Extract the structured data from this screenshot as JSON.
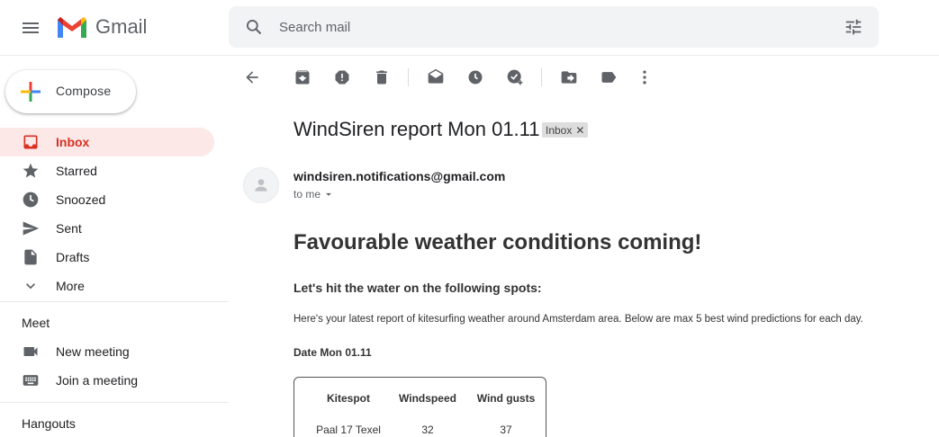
{
  "app": {
    "name": "Gmail"
  },
  "search": {
    "placeholder": "Search mail"
  },
  "compose": {
    "label": "Compose"
  },
  "nav": [
    {
      "label": "Inbox",
      "icon": "inbox-icon",
      "active": true
    },
    {
      "label": "Starred",
      "icon": "star-icon"
    },
    {
      "label": "Snoozed",
      "icon": "clock-icon"
    },
    {
      "label": "Sent",
      "icon": "send-icon"
    },
    {
      "label": "Drafts",
      "icon": "draft-icon"
    },
    {
      "label": "More",
      "icon": "chevron-down-icon"
    }
  ],
  "meet": {
    "title": "Meet",
    "items": [
      {
        "label": "New meeting",
        "icon": "video-icon"
      },
      {
        "label": "Join a meeting",
        "icon": "keyboard-icon"
      }
    ]
  },
  "hangouts": {
    "title": "Hangouts"
  },
  "toolbar": {
    "icons": [
      "back-icon",
      "archive-icon",
      "report-spam-icon",
      "delete-icon",
      "mark-unread-icon",
      "snooze-icon",
      "add-task-icon",
      "move-to-icon",
      "label-icon",
      "more-vert-icon"
    ]
  },
  "message": {
    "subject": "WindSiren report Mon 01.11",
    "label_chip": "Inbox",
    "sender": "windsiren.notifications@gmail.com",
    "recipient": "to me",
    "heading": "Favourable weather conditions coming!",
    "subheading": "Let's hit the water on the following spots:",
    "intro": "Here's your latest report of kitesurfing weather around Amsterdam area. Below are max 5 best wind predictions for each day.",
    "date_line": "Date Mon 01.11",
    "table": {
      "headers": [
        "Kitespot",
        "Windspeed",
        "Wind gusts"
      ],
      "rows": [
        [
          "Paal 17 Texel",
          "32",
          "37"
        ]
      ]
    }
  },
  "colors": {
    "accent": "#d93025",
    "active_bg": "#fce8e6",
    "search_bg": "#f1f3f4"
  }
}
